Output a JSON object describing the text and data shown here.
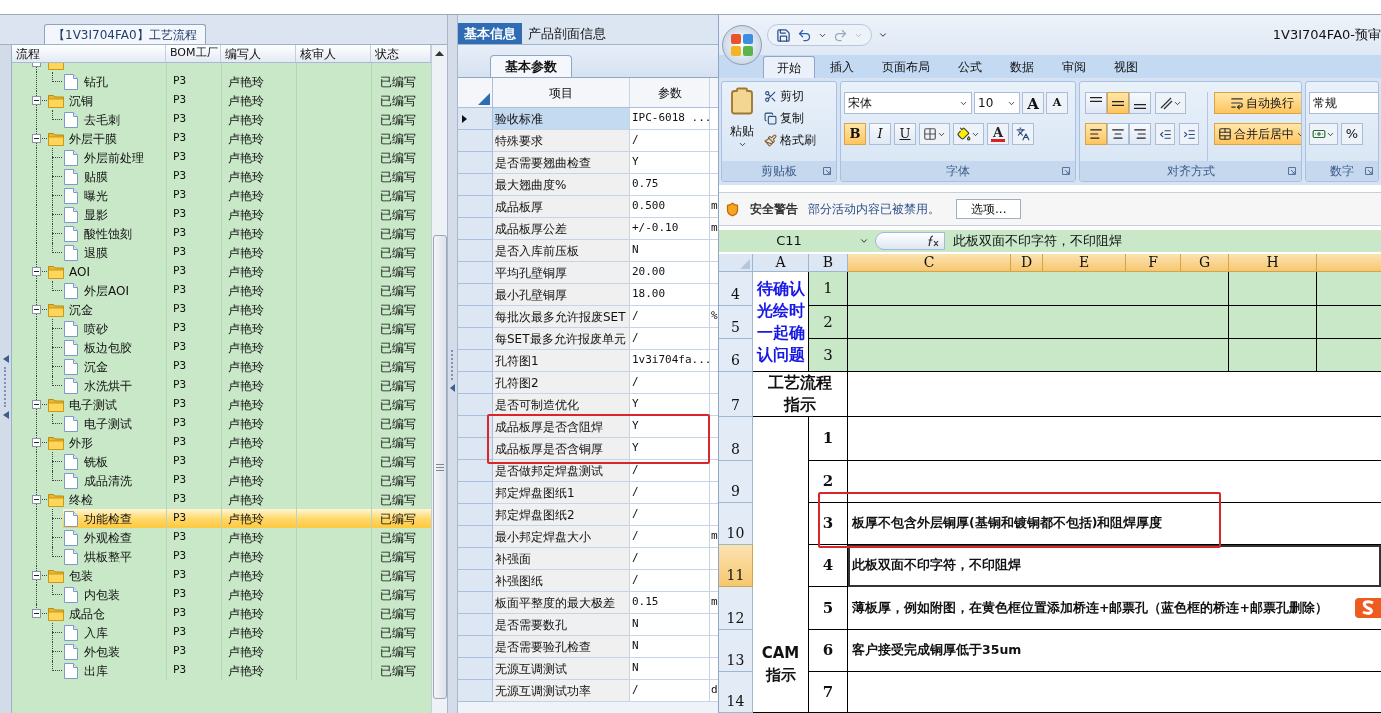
{
  "left_panel": {
    "title": "【1V3I704FA0】工艺流程",
    "columns": [
      "流程",
      "BOM工厂",
      "编写人",
      "核审人",
      "状态"
    ],
    "tree": [
      {
        "children": [
          {
            "name": "钻孔",
            "bom": "P3",
            "writer": "卢艳玲",
            "status": "已编写",
            "selected": false
          }
        ]
      },
      {
        "name": "沉铜",
        "bom": "P3",
        "writer": "卢艳玲",
        "status": "已编写",
        "expanded": true,
        "selected": false,
        "children": [
          {
            "name": "去毛刺",
            "bom": "P3",
            "writer": "卢艳玲",
            "status": "已编写",
            "selected": false
          }
        ]
      },
      {
        "name": "外层干膜",
        "bom": "P3",
        "writer": "卢艳玲",
        "status": "已编写",
        "expanded": true,
        "selected": false,
        "children": [
          {
            "name": "外层前处理",
            "bom": "P3",
            "writer": "卢艳玲",
            "status": "已编写",
            "selected": false
          },
          {
            "name": "贴膜",
            "bom": "P3",
            "writer": "卢艳玲",
            "status": "已编写",
            "selected": false
          },
          {
            "name": "曝光",
            "bom": "P3",
            "writer": "卢艳玲",
            "status": "已编写",
            "selected": false
          },
          {
            "name": "显影",
            "bom": "P3",
            "writer": "卢艳玲",
            "status": "已编写",
            "selected": false
          },
          {
            "name": "酸性蚀刻",
            "bom": "P3",
            "writer": "卢艳玲",
            "status": "已编写",
            "selected": false
          },
          {
            "name": "退膜",
            "bom": "P3",
            "writer": "卢艳玲",
            "status": "已编写",
            "selected": false
          }
        ]
      },
      {
        "name": "AOI",
        "bom": "P3",
        "writer": "卢艳玲",
        "status": "已编写",
        "expanded": true,
        "selected": false,
        "children": [
          {
            "name": "外层AOI",
            "bom": "P3",
            "writer": "卢艳玲",
            "status": "已编写",
            "selected": false
          }
        ]
      },
      {
        "name": "沉金",
        "bom": "P3",
        "writer": "卢艳玲",
        "status": "已编写",
        "expanded": true,
        "selected": false,
        "children": [
          {
            "name": "喷砂",
            "bom": "P3",
            "writer": "卢艳玲",
            "status": "已编写",
            "selected": false
          },
          {
            "name": "板边包胶",
            "bom": "P3",
            "writer": "卢艳玲",
            "status": "已编写",
            "selected": false
          },
          {
            "name": "沉金",
            "bom": "P3",
            "writer": "卢艳玲",
            "status": "已编写",
            "selected": false
          },
          {
            "name": "水洗烘干",
            "bom": "P3",
            "writer": "卢艳玲",
            "status": "已编写",
            "selected": false
          }
        ]
      },
      {
        "name": "电子测试",
        "bom": "P3",
        "writer": "卢艳玲",
        "status": "已编写",
        "expanded": true,
        "selected": false,
        "children": [
          {
            "name": "电子测试",
            "bom": "P3",
            "writer": "卢艳玲",
            "status": "已编写",
            "selected": false
          }
        ]
      },
      {
        "name": "外形",
        "bom": "P3",
        "writer": "卢艳玲",
        "status": "已编写",
        "expanded": true,
        "selected": false,
        "children": [
          {
            "name": "铣板",
            "bom": "P3",
            "writer": "卢艳玲",
            "status": "已编写",
            "selected": false
          },
          {
            "name": "成品清洗",
            "bom": "P3",
            "writer": "卢艳玲",
            "status": "已编写",
            "selected": false
          }
        ]
      },
      {
        "name": "终检",
        "bom": "P3",
        "writer": "卢艳玲",
        "status": "已编写",
        "expanded": true,
        "selected": false,
        "children": [
          {
            "name": "功能检查",
            "bom": "P3",
            "writer": "卢艳玲",
            "status": "已编写",
            "selected": true
          },
          {
            "name": "外观检查",
            "bom": "P3",
            "writer": "卢艳玲",
            "status": "已编写",
            "selected": false
          },
          {
            "name": "烘板整平",
            "bom": "P3",
            "writer": "卢艳玲",
            "status": "已编写",
            "selected": false
          }
        ]
      },
      {
        "name": "包装",
        "bom": "P3",
        "writer": "卢艳玲",
        "status": "已编写",
        "expanded": true,
        "selected": false,
        "children": [
          {
            "name": "内包装",
            "bom": "P3",
            "writer": "卢艳玲",
            "status": "已编写",
            "selected": false
          }
        ]
      },
      {
        "name": "成品仓",
        "bom": "P3",
        "writer": "卢艳玲",
        "status": "已编写",
        "expanded": true,
        "selected": false,
        "children": [
          {
            "name": "入库",
            "bom": "P3",
            "writer": "卢艳玲",
            "status": "已编写",
            "selected": false
          },
          {
            "name": "外包装",
            "bom": "P3",
            "writer": "卢艳玲",
            "status": "已编写",
            "selected": false
          },
          {
            "name": "出库",
            "bom": "P3",
            "writer": "卢艳玲",
            "status": "已编写",
            "selected": false
          }
        ]
      }
    ]
  },
  "middle_panel": {
    "tabs": [
      {
        "label": "基本信息",
        "selected": true
      },
      {
        "label": "产品剖面信息",
        "selected": false
      }
    ],
    "subtab": "基本参数",
    "grid": {
      "columns": [
        "项目",
        "参数"
      ],
      "rows": [
        {
          "item": "验收标准",
          "value": "IPC-6018 ...",
          "selected": true,
          "boxed": false
        },
        {
          "item": "特殊要求",
          "value": "/",
          "selected": false,
          "boxed": false
        },
        {
          "item": "是否需要翘曲检查",
          "value": "Y",
          "selected": false,
          "boxed": false
        },
        {
          "item": "最大翘曲度%",
          "value": "0.75",
          "selected": false,
          "boxed": false
        },
        {
          "item": "成品板厚",
          "value": "0.500",
          "column_3": "m",
          "selected": false,
          "boxed": false
        },
        {
          "item": "成品板厚公差",
          "value": "+/-0.10",
          "column_3": "m",
          "selected": false,
          "boxed": false
        },
        {
          "item": "是否入库前压板",
          "value": "N",
          "selected": false,
          "boxed": false
        },
        {
          "item": "平均孔壁铜厚",
          "value": "20.00",
          "selected": false,
          "boxed": false
        },
        {
          "item": "最小孔壁铜厚",
          "value": "18.00",
          "selected": false,
          "boxed": false
        },
        {
          "item": "每批次最多允许报废SET",
          "value": "/",
          "column_3": "%",
          "selected": false,
          "boxed": false
        },
        {
          "item": "每SET最多允许报废单元",
          "value": "/",
          "selected": false,
          "boxed": false
        },
        {
          "item": "孔符图1",
          "value": "1v3i704fa...",
          "selected": false,
          "boxed": false
        },
        {
          "item": "孔符图2",
          "value": "/",
          "selected": false,
          "boxed": false
        },
        {
          "item": "是否可制造优化",
          "value": "Y",
          "selected": false,
          "boxed": false
        },
        {
          "item": "成品板厚是否含阻焊",
          "value": "Y",
          "selected": false,
          "boxed": true
        },
        {
          "item": "成品板厚是否含铜厚",
          "value": "Y",
          "selected": false,
          "boxed": true
        },
        {
          "item": "是否做邦定焊盘测试",
          "value": "/",
          "selected": false,
          "boxed": false
        },
        {
          "item": "邦定焊盘图纸1",
          "value": "/",
          "selected": false,
          "boxed": false
        },
        {
          "item": "邦定焊盘图纸2",
          "value": "/",
          "selected": false,
          "boxed": false
        },
        {
          "item": "最小邦定焊盘大小",
          "value": "/",
          "column_3": "m",
          "selected": false,
          "boxed": false
        },
        {
          "item": "补强面",
          "value": "/",
          "selected": false,
          "boxed": false
        },
        {
          "item": "补强图纸",
          "value": "/",
          "selected": false,
          "boxed": false
        },
        {
          "item": "板面平整度的最大极差",
          "value": "0.15",
          "column_3": "m",
          "selected": false,
          "boxed": false
        },
        {
          "item": "是否需要数孔",
          "value": "N",
          "selected": false,
          "boxed": false
        },
        {
          "item": "是否需要验孔检查",
          "value": "N",
          "selected": false,
          "boxed": false
        },
        {
          "item": "无源互调测试",
          "value": "N",
          "selected": false,
          "boxed": false
        },
        {
          "item": "无源互调测试功率",
          "value": "/",
          "column_3": "d",
          "selected": false,
          "boxed": false
        }
      ]
    }
  },
  "excel": {
    "title": "1V3I704FA0-预审",
    "ribbon_tabs": [
      {
        "label": "开始",
        "selected": true
      },
      {
        "label": "插入",
        "selected": false
      },
      {
        "label": "页面布局",
        "selected": false
      },
      {
        "label": "公式",
        "selected": false
      },
      {
        "label": "数据",
        "selected": false
      },
      {
        "label": "审阅",
        "selected": false
      },
      {
        "label": "视图",
        "selected": false
      }
    ],
    "clipboard": {
      "label": "剪贴板",
      "paste": "粘贴",
      "cut": "剪切",
      "copy": "复制",
      "format_painter": "格式刷"
    },
    "font": {
      "label": "字体",
      "name": "宋体",
      "size": "10",
      "grow": "A",
      "shrink": "A",
      "font_color_button": "A",
      "buttons": [
        {
          "label": "B",
          "kind": "bold",
          "on": true
        },
        {
          "label": "I",
          "kind": "italic",
          "on": false
        },
        {
          "label": "U",
          "kind": "underline",
          "on": false
        }
      ]
    },
    "alignment": {
      "label": "对齐方式",
      "vertical": [
        {
          "kind": "top",
          "selected": false
        },
        {
          "kind": "middle",
          "selected": true
        },
        {
          "kind": "bottom",
          "selected": false
        }
      ],
      "horizontal": [
        {
          "kind": "left",
          "selected": true
        },
        {
          "kind": "center",
          "selected": false
        },
        {
          "kind": "right",
          "selected": false
        }
      ],
      "wrap_text": {
        "label": "自动换行",
        "on": true
      },
      "merge_center": {
        "label": "合并后居中",
        "on": true
      }
    },
    "number": {
      "label": "数字",
      "format": "常规",
      "percent": "%"
    },
    "security": {
      "title": "安全警告",
      "message": "部分活动内容已被禁用。",
      "button": "选项..."
    },
    "formula_bar": {
      "cell": "C11",
      "content": "此板双面不印字符，不印阻焊"
    },
    "sheet": {
      "columns": [
        {
          "label": "A",
          "selected": false
        },
        {
          "label": "B",
          "selected": false
        },
        {
          "label": "C",
          "selected": true
        },
        {
          "label": "D",
          "selected": true
        },
        {
          "label": "E",
          "selected": true
        },
        {
          "label": "F",
          "selected": true
        },
        {
          "label": "G",
          "selected": true
        },
        {
          "label": "H",
          "selected": true
        }
      ],
      "rows": [
        {
          "label": "4",
          "selected": false
        },
        {
          "label": "5",
          "selected": false
        },
        {
          "label": "6",
          "selected": false
        },
        {
          "label": "7",
          "selected": false
        },
        {
          "label": "8",
          "selected": false
        },
        {
          "label": "9",
          "selected": false
        },
        {
          "label": "10",
          "selected": false
        },
        {
          "label": "11",
          "selected": true
        },
        {
          "label": "12",
          "selected": false
        },
        {
          "label": "13",
          "selected": false
        },
        {
          "label": "14",
          "selected": false
        }
      ],
      "confirm_block": {
        "heading": "待确认光绘时一起确认问题",
        "items": [
          "1",
          "2",
          "3"
        ]
      },
      "process_heading": "工艺流程指示",
      "cam_block": {
        "heading": "CAM指示",
        "items": [
          {
            "no": "1",
            "selected": false,
            "boxed": false
          },
          {
            "no": "2",
            "selected": false,
            "boxed": false
          },
          {
            "no": "3",
            "text": "板厚不包含外层铜厚(基铜和镀铜都不包括)和阻焊厚度",
            "selected": false,
            "boxed": true
          },
          {
            "no": "4",
            "text": "此板双面不印字符，不印阻焊",
            "selected": true,
            "boxed": false
          },
          {
            "no": "5",
            "text": "薄板厚，例如附图，在黄色框位置添加桥连+邮票孔（蓝色框的桥连+邮票孔删除）",
            "selected": false,
            "boxed": false
          },
          {
            "no": "6",
            "text": "客户接受完成铜厚低于35um",
            "selected": false,
            "boxed": false
          },
          {
            "no": "7",
            "selected": false,
            "boxed": false
          }
        ]
      }
    }
  }
}
